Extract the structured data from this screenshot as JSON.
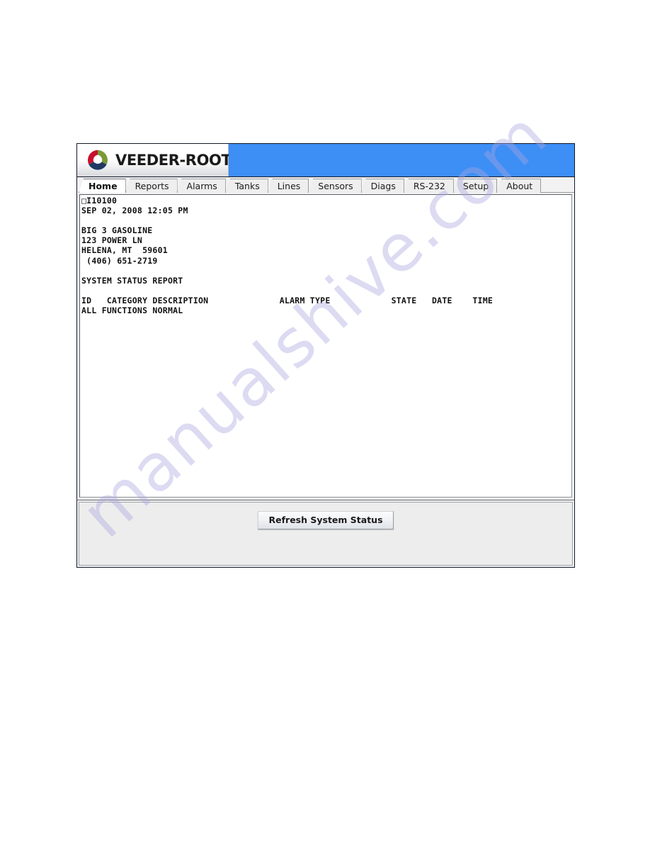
{
  "watermark": {
    "text": "manualshive.com"
  },
  "header": {
    "brand_name": "VEEDER-ROOT",
    "trademark": "®",
    "banner_color": "#3d8ef5",
    "logo_icon": "veeder-root-swirl-logo",
    "logo_colors": {
      "red": "#c8102e",
      "green": "#7a9a36",
      "navy": "#1f3864"
    }
  },
  "tabs": [
    {
      "label": "Home",
      "active": true
    },
    {
      "label": "Reports",
      "active": false
    },
    {
      "label": "Alarms",
      "active": false
    },
    {
      "label": "Tanks",
      "active": false
    },
    {
      "label": "Lines",
      "active": false
    },
    {
      "label": "Sensors",
      "active": false
    },
    {
      "label": "Diags",
      "active": false
    },
    {
      "label": "RS-232",
      "active": false
    },
    {
      "label": "Setup",
      "active": false
    },
    {
      "label": "About",
      "active": false
    }
  ],
  "report": {
    "terminal_id": "I10100",
    "timestamp": "SEP 02, 2008 12:05 PM",
    "site_name": "BIG 3 GASOLINE",
    "site_address": "123 POWER LN",
    "site_city_state_zip": "HELENA, MT  59601",
    "site_phone": "(406) 651-2719",
    "report_title": "SYSTEM STATUS REPORT",
    "columns": [
      "ID",
      "CATEGORY",
      "DESCRIPTION",
      "ALARM TYPE",
      "STATE",
      "DATE",
      "TIME"
    ],
    "status_line": "ALL FUNCTIONS NORMAL",
    "body": "□I10100\nSEP 02, 2008 12:05 PM\n\nBIG 3 GASOLINE\n123 POWER LN\nHELENA, MT  59601\n (406) 651-2719\n\nSYSTEM STATUS REPORT\n\nID   CATEGORY DESCRIPTION              ALARM TYPE            STATE   DATE    TIME\nALL FUNCTIONS NORMAL"
  },
  "actions": {
    "refresh_label": "Refresh System Status"
  }
}
